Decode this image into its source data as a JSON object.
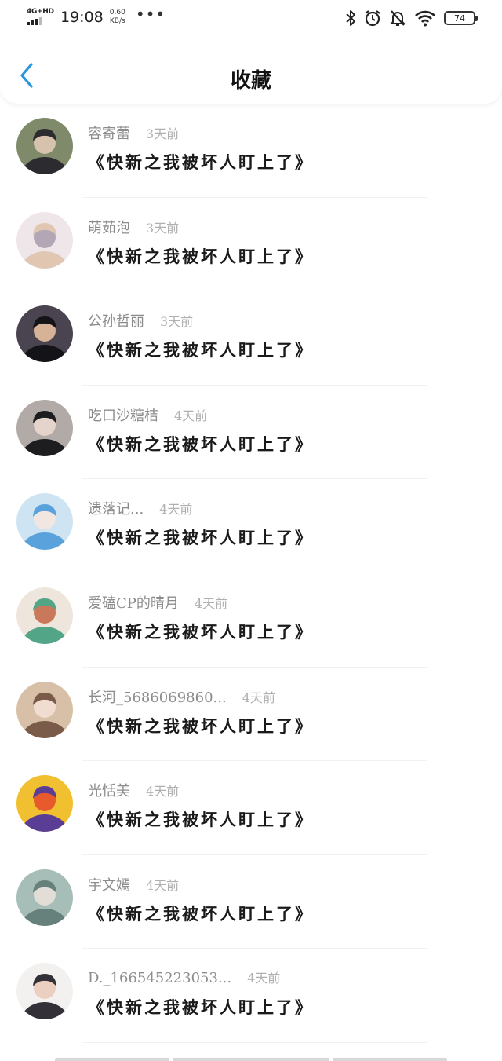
{
  "status_bar": {
    "network": "4G+HD",
    "time": "19:08",
    "speed_value": "0.60",
    "speed_unit": "KB/s",
    "more": "•••",
    "battery": "74"
  },
  "header": {
    "title": "收藏"
  },
  "items": [
    {
      "username": "容寄蕾",
      "time": "3天前",
      "title": "《快新之我被坏人盯上了》",
      "avatar_colors": [
        "#7e8a6a",
        "#2c2c30",
        "#d7c2ae"
      ]
    },
    {
      "username": "萌茹泡",
      "time": "3天前",
      "title": "《快新之我被坏人盯上了》",
      "avatar_colors": [
        "#efe6ea",
        "#e1c7b2",
        "#b3a7b5"
      ]
    },
    {
      "username": "公孙哲丽",
      "time": "3天前",
      "title": "《快新之我被坏人盯上了》",
      "avatar_colors": [
        "#4a4350",
        "#141418",
        "#d6b297"
      ]
    },
    {
      "username": "吃口沙糖桔",
      "time": "4天前",
      "title": "《快新之我被坏人盯上了》",
      "avatar_colors": [
        "#b2aaa6",
        "#1d1c1f",
        "#e4d4cc"
      ]
    },
    {
      "username": "遗落记...",
      "time": "4天前",
      "title": "《快新之我被坏人盯上了》",
      "avatar_colors": [
        "#cfe4f3",
        "#59a2dc",
        "#f1e6e0"
      ]
    },
    {
      "username": "爱磕CP的晴月",
      "time": "4天前",
      "title": "《快新之我被坏人盯上了》",
      "avatar_colors": [
        "#eee6dd",
        "#52a586",
        "#c9785a"
      ]
    },
    {
      "username": "长河_5686069860...",
      "time": "4天前",
      "title": "《快新之我被坏人盯上了》",
      "avatar_colors": [
        "#d8c0a8",
        "#7a5a48",
        "#f0ddd0"
      ]
    },
    {
      "username": "光恬美",
      "time": "4天前",
      "title": "《快新之我被坏人盯上了》",
      "avatar_colors": [
        "#f1c030",
        "#5a3e95",
        "#e65a2c"
      ]
    },
    {
      "username": "宇文嫣",
      "time": "4天前",
      "title": "《快新之我被坏人盯上了》",
      "avatar_colors": [
        "#a6bdb8",
        "#66807b",
        "#e2ddd6"
      ]
    },
    {
      "username": "D._166545223053...",
      "time": "4天前",
      "title": "《快新之我被坏人盯上了》",
      "avatar_colors": [
        "#f3f1ef",
        "#343038",
        "#ebcfc0"
      ]
    }
  ]
}
